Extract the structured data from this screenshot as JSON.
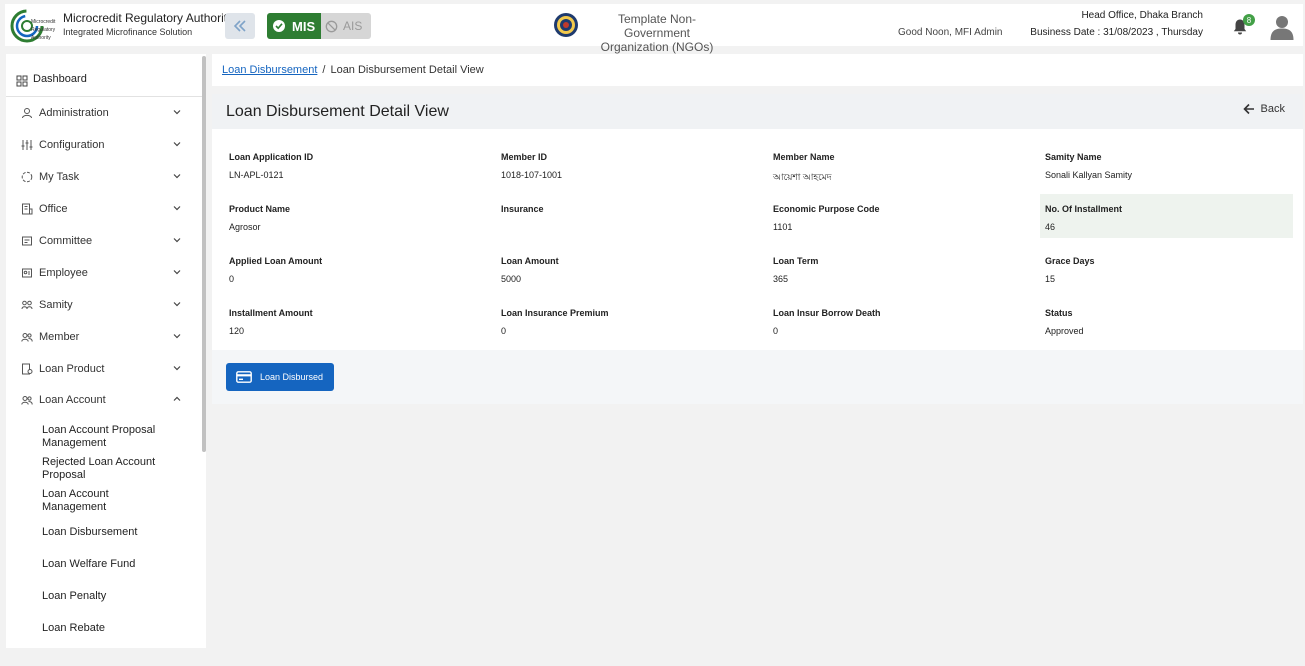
{
  "header": {
    "brand_title": "Microcredit Regulatory Authority",
    "brand_subtitle": "Integrated Microfinance Solution",
    "logo_text": [
      "Microcredit",
      "Regulatory",
      "Authority"
    ],
    "mis_label": "MIS",
    "ais_label": "AIS",
    "org_line1": "Template Non-Government",
    "org_line2": "Organization (NGOs)",
    "greeting": "Good Noon, MFI Admin",
    "branch": "Head Office, Dhaka Branch",
    "business_date": "Business Date : 31/08/2023 , Thursday",
    "notification_count": "8",
    "icons": [
      "collapse-icon",
      "check-icon",
      "block-icon",
      "seal-icon",
      "bell-icon",
      "user-avatar-icon"
    ]
  },
  "sidebar": {
    "dashboard": "Dashboard",
    "items": [
      {
        "label": "Administration",
        "icon": "admin-icon",
        "expanded": false
      },
      {
        "label": "Configuration",
        "icon": "sliders-icon",
        "expanded": false
      },
      {
        "label": "My Task",
        "icon": "task-icon",
        "expanded": false
      },
      {
        "label": "Office",
        "icon": "office-icon",
        "expanded": false
      },
      {
        "label": "Committee",
        "icon": "committee-icon",
        "expanded": false
      },
      {
        "label": "Employee",
        "icon": "employee-icon",
        "expanded": false
      },
      {
        "label": "Samity",
        "icon": "samity-icon",
        "expanded": false
      },
      {
        "label": "Member",
        "icon": "member-icon",
        "expanded": false
      },
      {
        "label": "Loan Product",
        "icon": "loan-product-icon",
        "expanded": false
      },
      {
        "label": "Loan Account",
        "icon": "loan-account-icon",
        "expanded": true
      }
    ],
    "subitems": [
      "Loan Account Proposal Management",
      "Rejected Loan Account Proposal",
      "Loan Account Management",
      "Loan Disbursement",
      "Loan Welfare Fund",
      "Loan Penalty",
      "Loan Rebate"
    ]
  },
  "breadcrumb": {
    "link": "Loan Disbursement",
    "separator": "/",
    "current": "Loan Disbursement Detail View"
  },
  "page": {
    "title": "Loan Disbursement Detail View",
    "back_label": "Back"
  },
  "details": {
    "rows": [
      [
        {
          "label": "Loan Application ID",
          "value": "LN-APL-0121"
        },
        {
          "label": "Member ID",
          "value": "1018-107-1001"
        },
        {
          "label": "Member Name",
          "value": "আয়েশা আহমেদ"
        },
        {
          "label": "Samity Name",
          "value": "Sonali Kallyan Samity"
        }
      ],
      [
        {
          "label": "Product Name",
          "value": "Agrosor"
        },
        {
          "label": "Insurance",
          "value": ""
        },
        {
          "label": "Economic Purpose Code",
          "value": "1101"
        },
        {
          "label": "No. Of Installment",
          "value": "46"
        }
      ],
      [
        {
          "label": "Applied Loan Amount",
          "value": "0"
        },
        {
          "label": "Loan Amount",
          "value": "5000"
        },
        {
          "label": "Loan Term",
          "value": "365"
        },
        {
          "label": "Grace Days",
          "value": "15"
        }
      ],
      [
        {
          "label": "Installment Amount",
          "value": "120"
        },
        {
          "label": "Loan Insurance Premium",
          "value": "0"
        },
        {
          "label": "Loan Insur Borrow Death",
          "value": "0"
        },
        {
          "label": "Status",
          "value": "Approved"
        }
      ]
    ]
  },
  "actions": {
    "disburse_label": "Loan Disbursed"
  },
  "colors": {
    "primary": "#1565c0",
    "mis_green": "#2e7d32",
    "badge_green": "#43a047"
  }
}
